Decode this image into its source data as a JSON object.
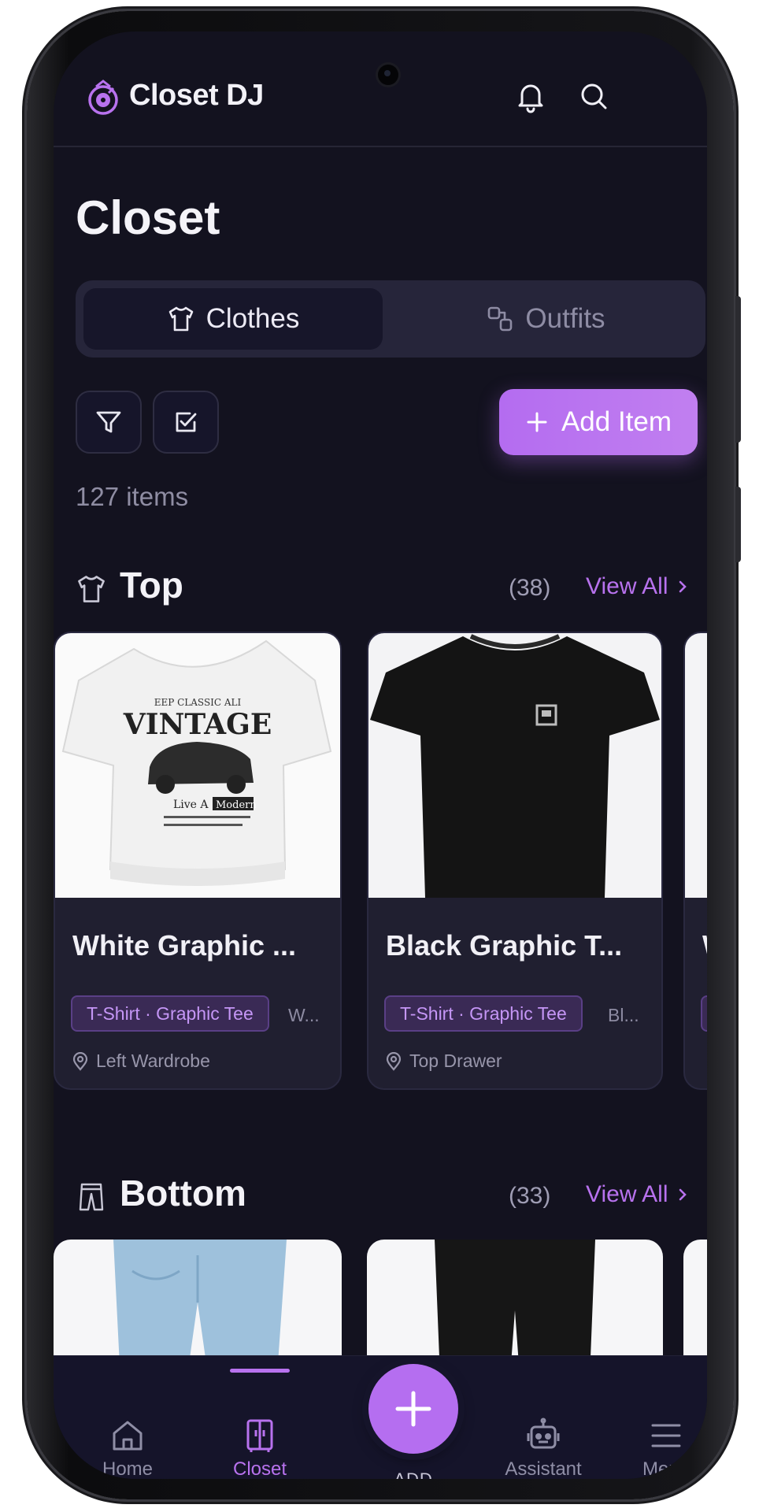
{
  "app": {
    "name": "Closet DJ"
  },
  "page": {
    "title": "Closet",
    "item_count": "127 items"
  },
  "tabs": [
    {
      "label": "Clothes",
      "active": true
    },
    {
      "label": "Outfits",
      "active": false
    }
  ],
  "actions": {
    "add_item": "Add Item"
  },
  "sections": [
    {
      "title": "Top",
      "count": "(38)",
      "view_all": "View All",
      "items": [
        {
          "name": "White Graphic ...",
          "chip": "T-Shirt · Graphic Tee",
          "extra": "W...",
          "location": "Left Wardrobe"
        },
        {
          "name": "Black Graphic T...",
          "chip": "T-Shirt · Graphic Tee",
          "extra": "Bl...",
          "location": "Top Drawer"
        },
        {
          "name": "W"
        }
      ]
    },
    {
      "title": "Bottom",
      "count": "(33)",
      "view_all": "View All"
    }
  ],
  "nav": {
    "items": [
      {
        "label": "Home",
        "icon": "home-icon"
      },
      {
        "label": "Closet",
        "icon": "closet-icon",
        "active": true
      },
      {
        "label": "ADD",
        "icon": "plus-icon"
      },
      {
        "label": "Assistant",
        "icon": "robot-icon"
      },
      {
        "label": "Menu",
        "icon": "menu-icon"
      }
    ]
  },
  "colors": {
    "accent": "#b872ee",
    "background": "#13121f",
    "card": "#201f30"
  }
}
